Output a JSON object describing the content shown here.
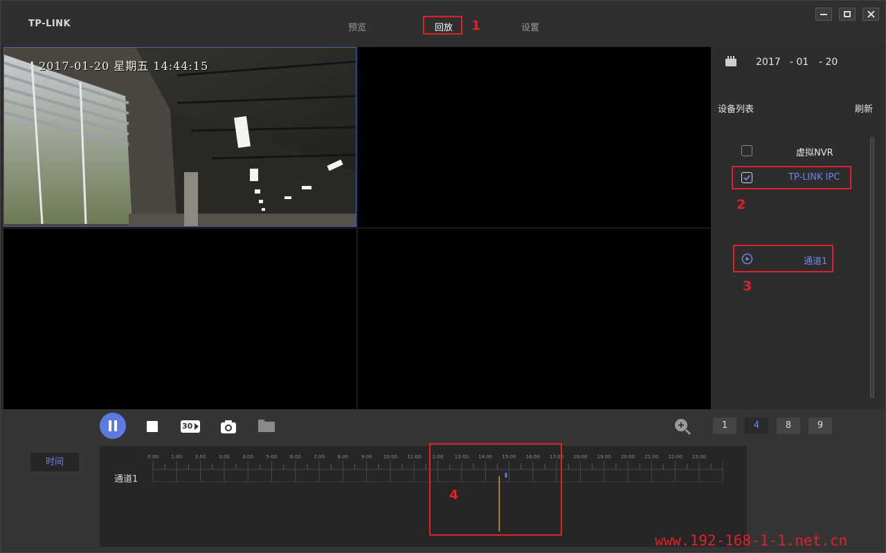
{
  "app": {
    "logo": "TP-LINK"
  },
  "nav": {
    "tabs": [
      {
        "label": "预览",
        "active": false
      },
      {
        "label": "回放",
        "active": true
      },
      {
        "label": "设置",
        "active": false
      }
    ]
  },
  "window_controls": [
    "minimize-icon",
    "maximize-icon",
    "close-icon"
  ],
  "video": {
    "osd_text": "2017-01-20 星期五 14:44:15"
  },
  "side": {
    "date": {
      "year": "2017",
      "month": "- 01",
      "day": "- 20"
    },
    "device_list_title": "设备列表",
    "refresh": "刷新",
    "devices": [
      {
        "name": "虚拟NVR",
        "checked": false
      },
      {
        "name": "TP-LINK IPC",
        "checked": true
      }
    ],
    "channels": [
      {
        "name": "通道1"
      }
    ]
  },
  "controls": {
    "icons": [
      "pause-icon",
      "stop-icon",
      "replay-30-icon",
      "camera-icon",
      "folder-icon",
      "zoom-in-icon"
    ],
    "replay_label": "30",
    "split_options": [
      "1",
      "4",
      "8",
      "9"
    ],
    "split_selected": "4",
    "time_label": "时间"
  },
  "timeline": {
    "hours": [
      "0:00",
      "1:00",
      "2:00",
      "3:00",
      "4:00",
      "5:00",
      "6:00",
      "7:00",
      "8:00",
      "9:00",
      "10:00",
      "11:00",
      "2:00",
      "13:00",
      "14:00",
      "15:00",
      "16:00",
      "17:00",
      "18:00",
      "19:00",
      "20:00",
      "21:00",
      "22:00",
      "23:00"
    ],
    "channel": "通道1",
    "cursor_time": "14:44",
    "recording_marker_time": "15:00"
  },
  "annotations": [
    "1",
    "2",
    "3",
    "4"
  ],
  "watermark": "www.192-168-1-1.net.cn",
  "colors": {
    "accent": "#5b7be0",
    "annotation": "#e0202a",
    "cursor": "#e0a020"
  }
}
